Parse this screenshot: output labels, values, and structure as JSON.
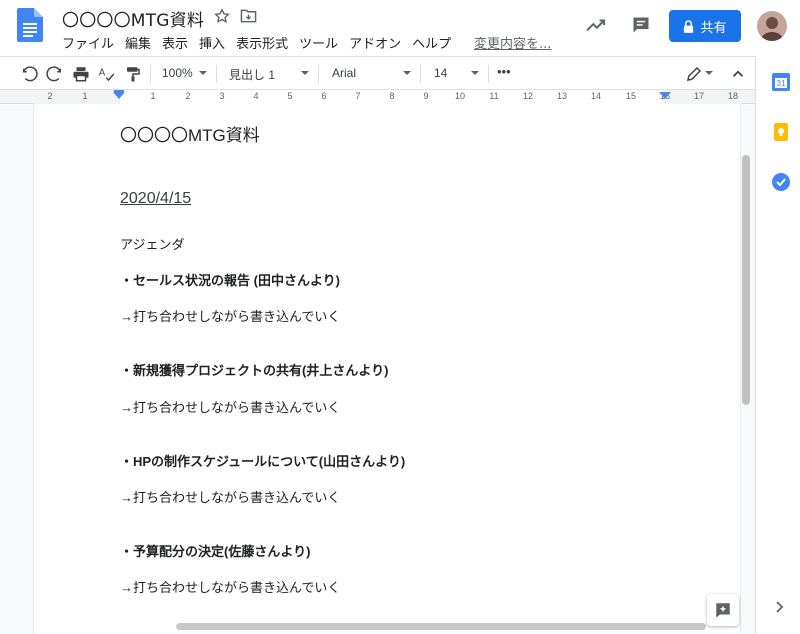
{
  "doc": {
    "title": "〇〇〇〇MTG資料",
    "last_edit": "変更内容を..."
  },
  "menu": [
    "ファイル",
    "編集",
    "表示",
    "挿入",
    "表示形式",
    "ツール",
    "アドオン",
    "ヘルプ"
  ],
  "share": {
    "label": "共有"
  },
  "toolbar": {
    "zoom": "100%",
    "style": "見出し 1",
    "font": "Arial",
    "font_size": "14",
    "more": "•••"
  },
  "ruler": {
    "numbers": [
      "2",
      "1",
      "1",
      "2",
      "3",
      "4",
      "5",
      "6",
      "7",
      "8",
      "9",
      "10",
      "11",
      "12",
      "13",
      "14",
      "15",
      "16",
      "17",
      "18"
    ]
  },
  "content": {
    "heading": "〇〇〇〇MTG資料",
    "date": "2020/4/15",
    "agenda_label": "アジェンダ",
    "items": [
      {
        "title": "・セールス状況の報告 (田中さんより)",
        "note": "→打ち合わせしながら書き込んでいく"
      },
      {
        "title": "・新規獲得プロジェクトの共有(井上さんより)",
        "note": "→打ち合わせしながら書き込んでいく"
      },
      {
        "title": "・HPの制作スケジュールについて(山田さんより)",
        "note": "→打ち合わせしながら書き込んでいく"
      },
      {
        "title": "・予算配分の決定(佐藤さんより)",
        "note": "→打ち合わせしながら書き込んでいく"
      }
    ]
  },
  "side_panel": {
    "calendar_day": "31",
    "icons": [
      "calendar-icon",
      "keep-icon",
      "tasks-icon",
      "chevron-right-icon"
    ]
  },
  "colors": {
    "accent": "#1a73e8",
    "docs_blue": "#4285f4",
    "keep_yellow": "#fbbc04"
  }
}
